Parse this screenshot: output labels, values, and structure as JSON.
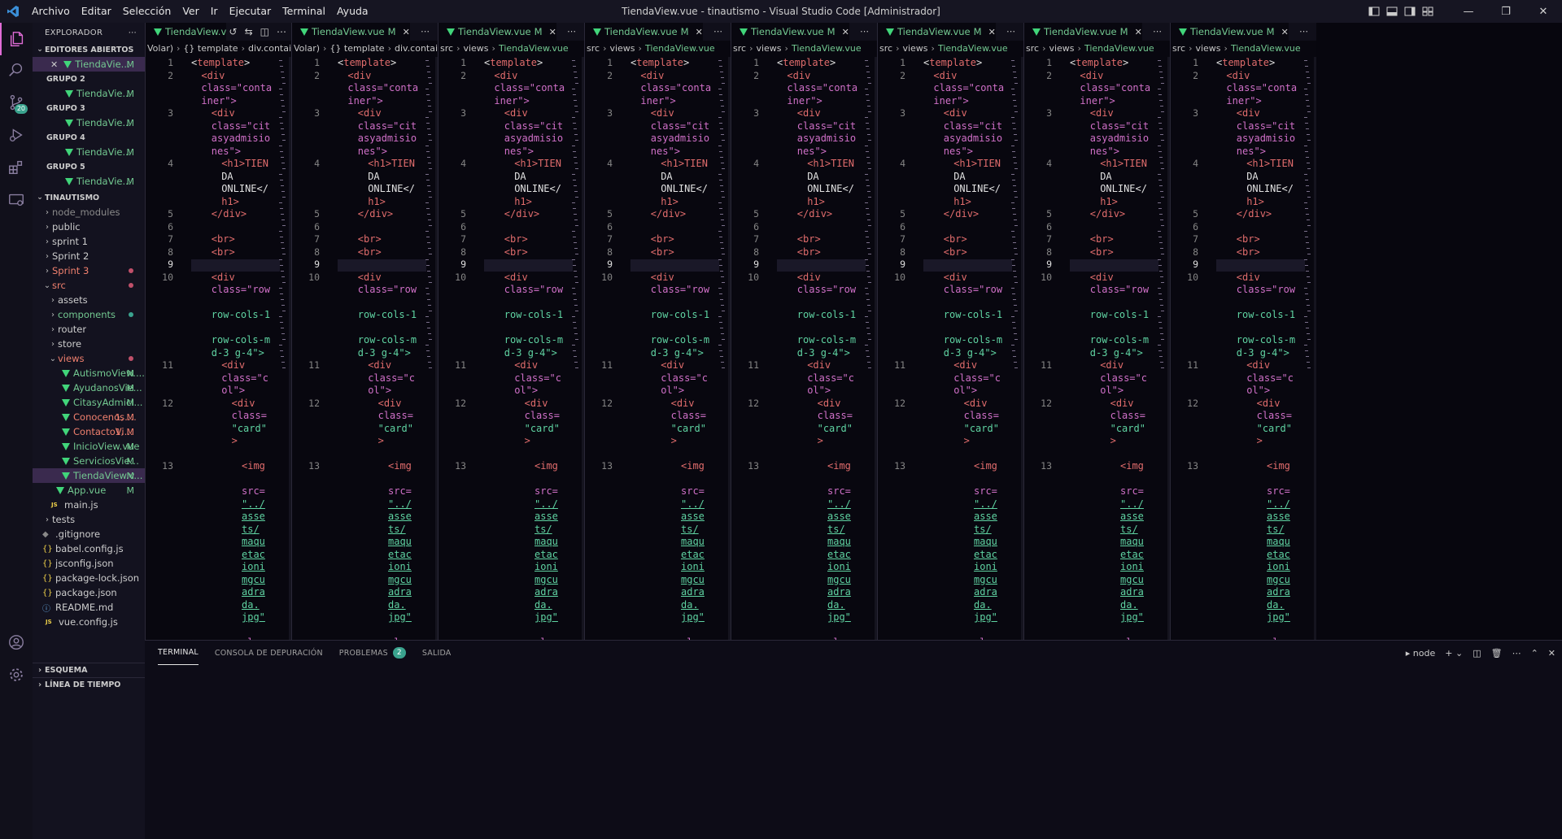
{
  "titlebar": {
    "title": "TiendaView.vue - tinautismo - Visual Studio Code [Administrador]",
    "menu": [
      "Archivo",
      "Editar",
      "Selección",
      "Ver",
      "Ir",
      "Ejecutar",
      "Terminal",
      "Ayuda"
    ]
  },
  "activity": {
    "scm_badge": "20"
  },
  "sidebar": {
    "header": "EXPLORADOR",
    "open_editors_title": "EDITORES ABIERTOS",
    "open_editors": [
      {
        "group": "",
        "label": "TiendaVie...",
        "flag": "M"
      },
      {
        "group": "GRUPO 2",
        "label": "TiendaVie...",
        "flag": "M"
      },
      {
        "group": "GRUPO 3",
        "label": "TiendaVie...",
        "flag": "M"
      },
      {
        "group": "GRUPO 4",
        "label": "TiendaVie...",
        "flag": "M"
      },
      {
        "group": "GRUPO 5",
        "label": "TiendaVie...",
        "flag": "M"
      }
    ],
    "project_title": "TINAUTISMO",
    "tree": [
      {
        "label": "node_modules"
      },
      {
        "label": "public"
      },
      {
        "label": "sprint 1"
      },
      {
        "label": "Sprint 2"
      },
      {
        "label": "Sprint 3"
      },
      {
        "label": "src"
      },
      {
        "label": "assets"
      },
      {
        "label": "components"
      },
      {
        "label": "router"
      },
      {
        "label": "store"
      },
      {
        "label": "views"
      },
      {
        "label": "AutismoView....",
        "flag": "M"
      },
      {
        "label": "AyudanosVie...",
        "flag": "M"
      },
      {
        "label": "CitasyAdmici...",
        "flag": "M"
      },
      {
        "label": "Conocenos....",
        "flag": "1, M"
      },
      {
        "label": "ContactoVi...",
        "flag": "1, M"
      },
      {
        "label": "InicioView.vue",
        "flag": "M"
      },
      {
        "label": "ServiciosView...",
        "flag": "M"
      },
      {
        "label": "TiendaView.v...",
        "flag": "M"
      },
      {
        "label": "App.vue",
        "flag": "M"
      },
      {
        "label": "main.js"
      },
      {
        "label": "tests"
      },
      {
        "label": ".gitignore"
      },
      {
        "label": "babel.config.js"
      },
      {
        "label": "jsconfig.json"
      },
      {
        "label": "package-lock.json"
      },
      {
        "label": "package.json"
      },
      {
        "label": "README.md"
      },
      {
        "label": "vue.config.js"
      }
    ],
    "outline_title": "ESQUEMA",
    "timeline_title": "LÍNEA DE TIEMPO"
  },
  "editor": {
    "tab_label": "TiendaView.vue",
    "tab_label_first": "TiendaView.v",
    "tab_flag": "M",
    "crumbs_first": [
      "Volar)",
      "{} template",
      "div.container"
    ],
    "crumbs_second": [
      "Volar)",
      "{} template",
      "div.container"
    ],
    "crumbs_other": [
      "src",
      "views",
      "TiendaView.vue"
    ],
    "line_numbers": [
      "1",
      "2",
      "3",
      "4",
      "5",
      "6",
      "7",
      "8",
      "9",
      "10",
      "11",
      "12",
      "13"
    ],
    "code_lines": [
      [
        "<",
        "template",
        ">"
      ],
      [
        "<div"
      ],
      [
        "class=\"conta"
      ],
      [
        "iner\">"
      ],
      [
        "<div"
      ],
      [
        "class=\"cit"
      ],
      [
        "asyadmisio"
      ],
      [
        "nes\">"
      ],
      [
        "<h1>TIEN"
      ],
      [
        "DA"
      ],
      [
        "ONLINE</"
      ],
      [
        "h1>"
      ],
      [
        "</div>"
      ],
      [
        ""
      ],
      [
        "<br>"
      ],
      [
        "<br>"
      ],
      [
        ""
      ],
      [
        "<div"
      ],
      [
        "class=\"row"
      ],
      [
        ""
      ],
      [
        "row-cols-1"
      ],
      [
        ""
      ],
      [
        "row-cols-m"
      ],
      [
        "d-3 g-4\">"
      ],
      [
        "<div"
      ],
      [
        "class=\"c"
      ],
      [
        "ol\">"
      ],
      [
        "<div"
      ],
      [
        "class="
      ],
      [
        "\"card\""
      ],
      [
        ">"
      ],
      [
        ""
      ],
      [
        "<img"
      ],
      [
        ""
      ],
      [
        "src="
      ],
      [
        "\"../"
      ],
      [
        "asse"
      ],
      [
        "ts/"
      ],
      [
        "maqu"
      ],
      [
        "etac"
      ],
      [
        "ioni"
      ],
      [
        "mgcu"
      ],
      [
        "adra"
      ],
      [
        "da."
      ],
      [
        "jpg\""
      ],
      [
        ""
      ],
      [
        "clas"
      ]
    ]
  },
  "panel": {
    "tabs": [
      "TERMINAL",
      "CONSOLA DE DEPURACIÓN",
      "PROBLEMAS",
      "SALIDA"
    ],
    "problems_count": "2",
    "shell": "node"
  },
  "colors": {
    "accent": "#e06cd6",
    "modified": "#73c991",
    "error": "#f0806e",
    "background": "#08070f"
  }
}
